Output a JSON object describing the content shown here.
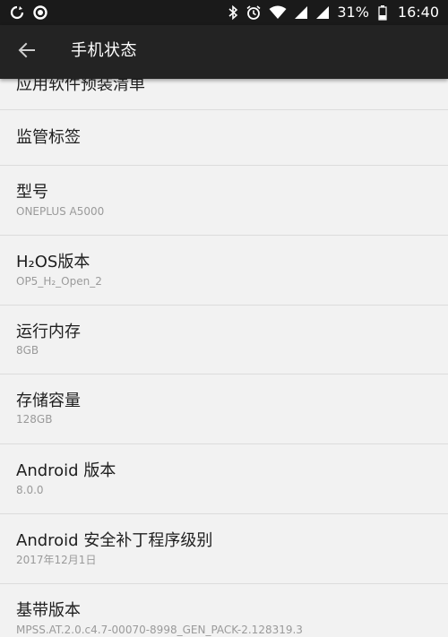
{
  "status_bar": {
    "battery_percent": "31%",
    "time": "16:40",
    "icons": [
      "sync-icon",
      "circle-icon",
      "bluetooth-icon",
      "alarm-icon",
      "wifi-icon",
      "signal-icon",
      "signal-icon",
      "battery-icon"
    ]
  },
  "app_bar": {
    "title": "手机状态",
    "back_icon": "arrow-left-icon"
  },
  "list": {
    "items": [
      {
        "title": "应用软件预装清单",
        "subtitle": ""
      },
      {
        "title": "监管标签",
        "subtitle": ""
      },
      {
        "title": "型号",
        "subtitle": "ONEPLUS A5000"
      },
      {
        "title": "H₂OS版本",
        "subtitle": "OP5_H₂_Open_2"
      },
      {
        "title": "运行内存",
        "subtitle": "8GB"
      },
      {
        "title": "存储容量",
        "subtitle": "128GB"
      },
      {
        "title": "Android 版本",
        "subtitle": "8.0.0"
      },
      {
        "title": "Android 安全补丁程序级别",
        "subtitle": "2017年12月1日"
      },
      {
        "title": "基带版本",
        "subtitle": "MPSS.AT.2.0.c4.7-00070-8998_GEN_PACK-2.128319.3"
      }
    ]
  },
  "colors": {
    "status_bar_bg": "#1a1a1a",
    "app_bar_bg": "#232323",
    "list_bg": "#f2f2f2",
    "divider": "#dcdcdc",
    "title_text": "#1e1e1e",
    "subtitle_text": "#9a9a9a"
  }
}
